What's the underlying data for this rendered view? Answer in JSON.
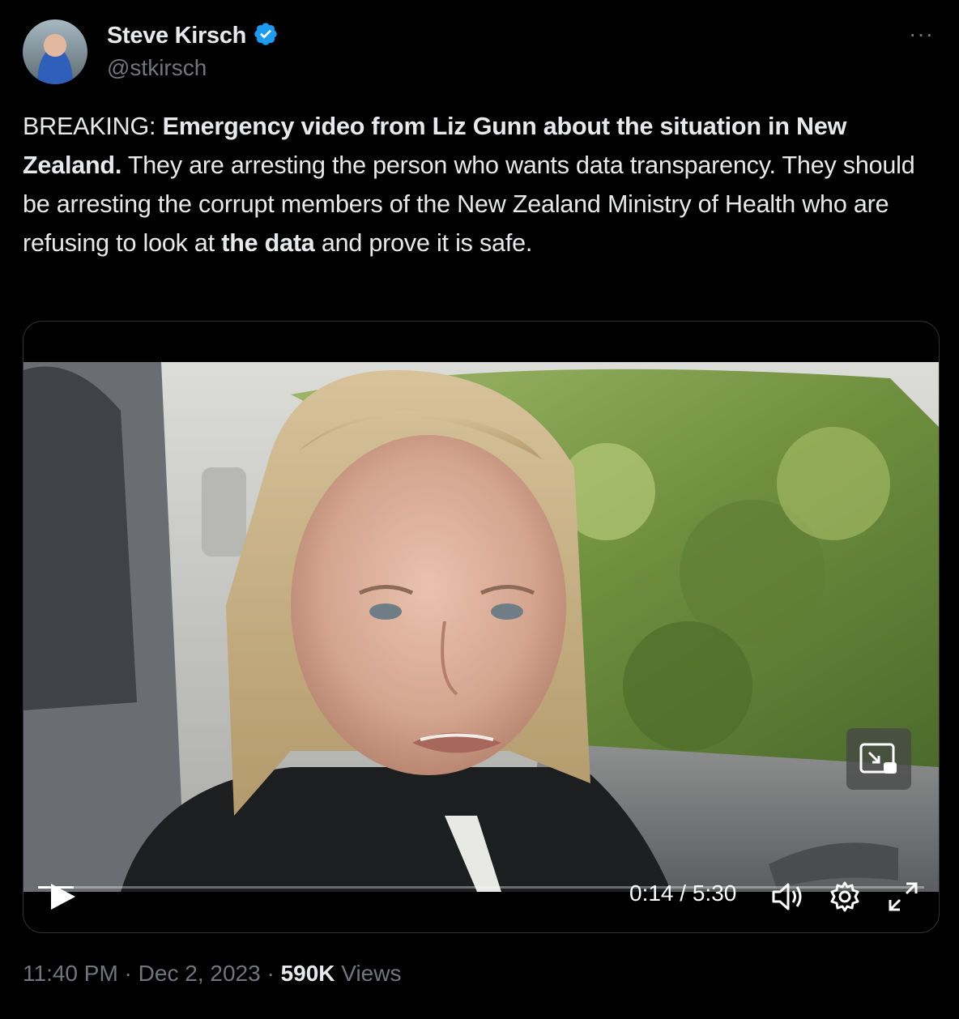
{
  "author": {
    "display_name": "Steve Kirsch",
    "handle": "@stkirsch",
    "verified_badge_color": "#1d9bf0"
  },
  "more_label": "···",
  "tweet": {
    "segments": [
      {
        "text": "BREAKING: ",
        "bold": false
      },
      {
        "text": "Emergency video from Liz Gunn about the situation in New Zealand.",
        "bold": true
      },
      {
        "text": " They are arresting the person who wants data transparency. They should be arresting the corrupt members of the New Zealand Ministry of Health who are refusing to look at ",
        "bold": false
      },
      {
        "text": "the data",
        "bold": true
      },
      {
        "text": " and prove it is safe.",
        "bold": false
      }
    ]
  },
  "video": {
    "current_time": "0:14",
    "separator": " / ",
    "duration": "5:30",
    "progress": 0.04,
    "controls": [
      "play-icon",
      "volume-icon",
      "settings-gear-icon",
      "fullscreen-icon",
      "picture-in-picture-icon"
    ]
  },
  "meta": {
    "time": "11:40 PM",
    "dot1": " · ",
    "date": "Dec 2, 2023",
    "dot2": " · ",
    "views_count": "590K",
    "views_label": " Views"
  },
  "colors": {
    "background": "#000000",
    "text_primary": "#e7e9ea",
    "text_secondary": "#71767b",
    "border": "#2f3336",
    "accent": "#1d9bf0"
  }
}
